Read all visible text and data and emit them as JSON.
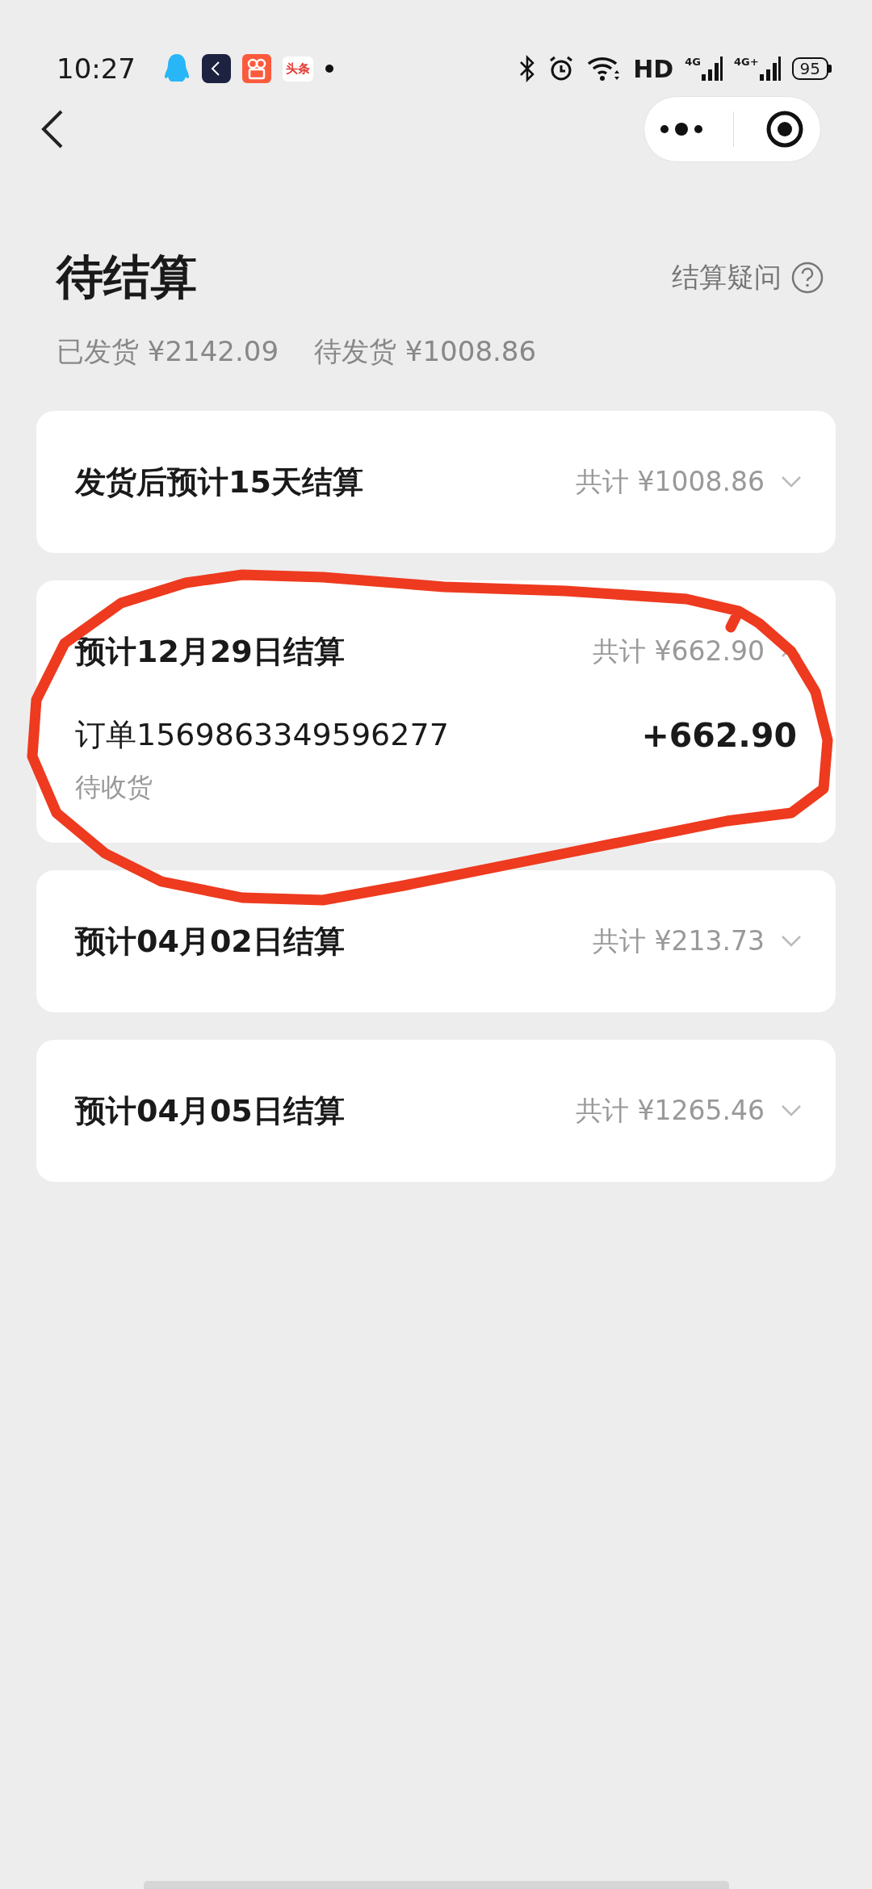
{
  "status_bar": {
    "time": "10:27",
    "news_app_label": "头条",
    "network": "HD",
    "signals": [
      "4G",
      "4G+"
    ],
    "battery": "95"
  },
  "header": {
    "title": "待结算",
    "help_link": "结算疑问",
    "shipped": "已发货 ¥2142.09",
    "pending": "待发货 ¥1008.86"
  },
  "groups": [
    {
      "title": "发货后预计15天结算",
      "total": "共计 ¥1008.86",
      "expanded": false
    },
    {
      "title": "预计12月29日结算",
      "total": "共计 ¥662.90",
      "expanded": true,
      "orders": [
        {
          "title": "订单1569863349596277",
          "amount": "+662.90",
          "status": "待收货"
        }
      ],
      "annotation": {
        "kind": "freehand_circle"
      }
    },
    {
      "title": "预计04月02日结算",
      "total": "共计 ¥213.73",
      "expanded": false
    },
    {
      "title": "预计04月05日结算",
      "total": "共计 ¥1265.46",
      "expanded": false
    }
  ]
}
